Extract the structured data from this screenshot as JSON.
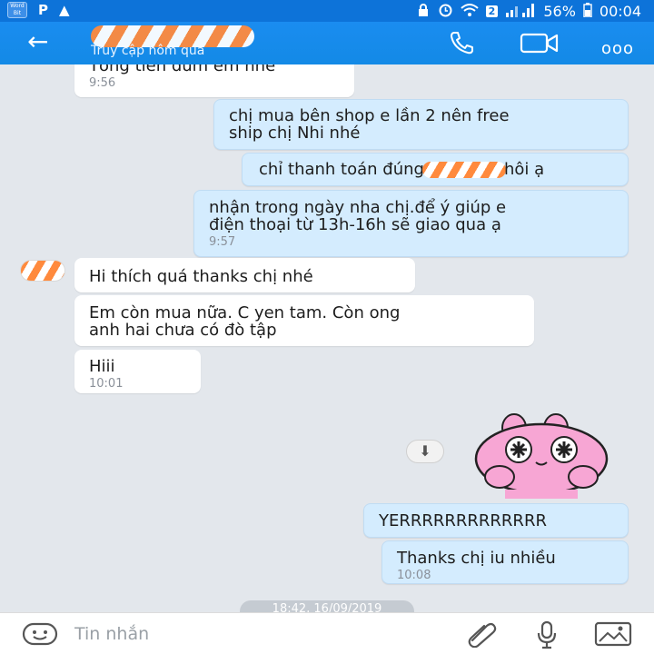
{
  "status_bar": {
    "app_icon_label": "Word Bit",
    "app_letter": "P",
    "warning": "▲",
    "sim_badge": "2",
    "battery": "56%",
    "time": "00:04"
  },
  "header": {
    "last_seen": "Truy cập hôm qua",
    "back_glyph": "←",
    "more_glyph": "ooo"
  },
  "messages": [
    {
      "id": "m1",
      "direction": "in",
      "text": "Tổng tiền dưm em nhé",
      "time": "9:56"
    },
    {
      "id": "m2",
      "direction": "out",
      "lines": [
        "chị mua bên shop e lần 2 nên free",
        "ship chị Nhi nhé"
      ],
      "time": ""
    },
    {
      "id": "m3",
      "direction": "out",
      "text_before": "chỉ thanh toán đúng",
      "text_after": "hôi ạ",
      "time": ""
    },
    {
      "id": "m4",
      "direction": "out",
      "lines": [
        "nhận trong ngày nha chị.để ý giúp e",
        "điện thoại từ 13h-16h sẽ giao qua ạ"
      ],
      "time": "9:57"
    },
    {
      "id": "m5",
      "direction": "in",
      "text": "Hi thích quá thanks chị nhé",
      "time": ""
    },
    {
      "id": "m6",
      "direction": "in",
      "lines": [
        "Em còn mua nữa. C yen tam. Còn ong",
        "anh hai chưa có đò tập"
      ],
      "time": ""
    },
    {
      "id": "m7",
      "direction": "in",
      "text": "Hiii",
      "time": "10:01"
    },
    {
      "id": "m8",
      "direction": "out",
      "text": "YERRRRRRRRRRRRR",
      "time": ""
    },
    {
      "id": "m9",
      "direction": "out",
      "text": "Thanks chị iu nhiều",
      "time": "10:08"
    }
  ],
  "download_glyph": "⬇",
  "date_separator": "18:42, 16/09/2019",
  "composer": {
    "placeholder": "Tin nhắn"
  },
  "colors": {
    "header_blue": "#138ae6",
    "outgoing_bubble": "#d4ecfe",
    "incoming_bubble": "#ffffff",
    "chat_background": "#e3e7ec",
    "sticker_pink": "#f7a6d4"
  },
  "icons": [
    "back-arrow-icon",
    "phone-icon",
    "video-icon",
    "more-icon",
    "download-icon",
    "emoji-icon",
    "attach-icon",
    "mic-icon",
    "image-icon"
  ]
}
